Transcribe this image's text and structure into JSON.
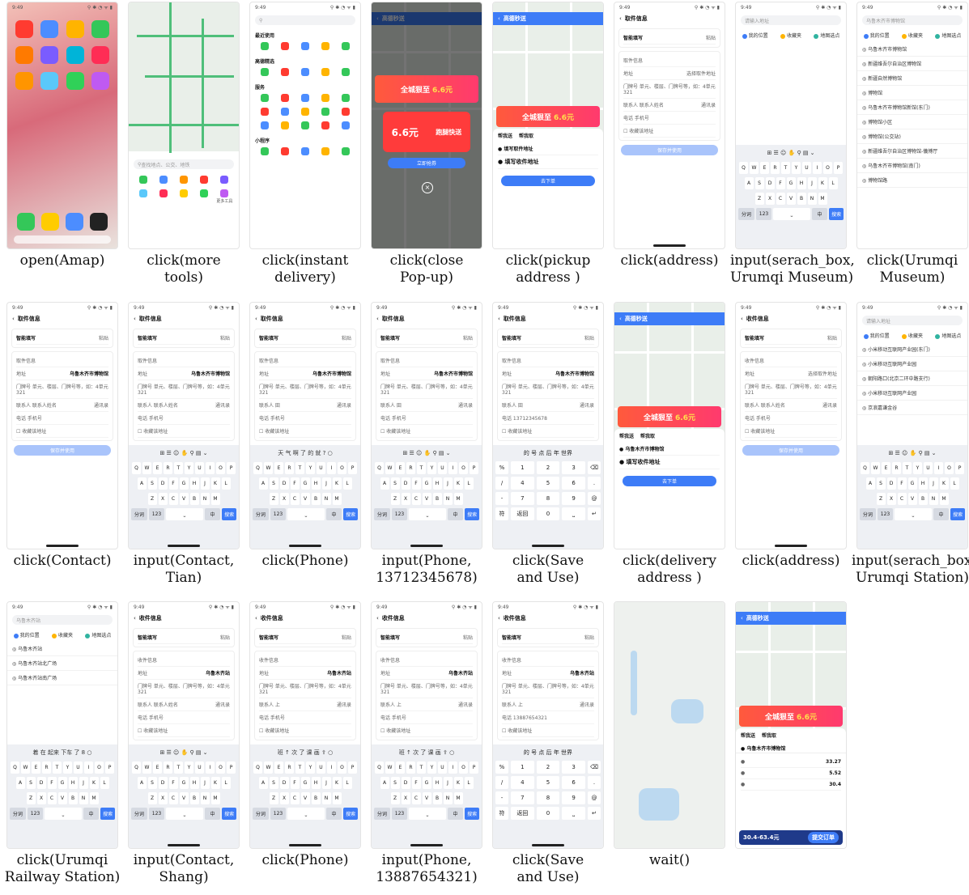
{
  "captions": [
    [
      "open(Amap)"
    ],
    [
      "click(more",
      "tools)"
    ],
    [
      "click(instant",
      "delivery)"
    ],
    [
      "click(close",
      "Pop-up)"
    ],
    [
      "click(pickup",
      "address )"
    ],
    [
      "click(address)"
    ],
    [
      "input(serach_box,",
      "Urumqi Museum)"
    ],
    [
      "click(Urumqi",
      "Museum)"
    ],
    [
      "click(Contact)"
    ],
    [
      "input(Contact,",
      "Tian)"
    ],
    [
      "click(Phone)"
    ],
    [
      "input(Phone,",
      "13712345678)"
    ],
    [
      "click(Save",
      "and Use)"
    ],
    [
      "click(delivery",
      "address )"
    ],
    [
      "click(address)"
    ],
    [
      "input(serach_box,",
      "Urumqi Station)"
    ],
    [
      "click(Urumqi",
      "Railway Station)"
    ],
    [
      "input(Contact,",
      "Shang)"
    ],
    [
      "click(Phone)"
    ],
    [
      "input(Phone,",
      "13887654321)"
    ],
    [
      "click(Save",
      "and Use)"
    ],
    [
      "wait()"
    ]
  ],
  "status": {
    "time": "9:49",
    "icons": "⚲ ✱ ◔ ᯤ ▮"
  },
  "pickup_header": "取件信息",
  "receive_header": "收件信息",
  "smart_fill": "智能填写",
  "paste": "粘贴",
  "pickup_info": "取件信息",
  "receive_info": "收件信息",
  "address_label": "地址",
  "address_museum": "乌鲁木齐市博物馆",
  "address_station": "乌鲁木齐站",
  "address_placeholder": "选择取件地址",
  "doorplate": "门牌号 单元、楼层、门牌号等，如：4单元321",
  "contact_label": "联系人",
  "contact_placeholder": "联系人姓名",
  "contact_tian": "田",
  "contact_shang": "上",
  "addressbook": "通讯录",
  "phone_label": "电话",
  "phone_placeholder": "手机号",
  "phone_tian": "13712345678",
  "phone_shang": "13887654321",
  "save_addr": "收藏该地址",
  "save_use": "保存并使用",
  "search_placeholder": "请输入地址",
  "search_museum": "乌鲁木齐市博物馆",
  "search_station": "乌鲁木齐站",
  "tabs": [
    "我的位置",
    "收藏夹",
    "地图选点"
  ],
  "amap_title": "高德秒送",
  "promo": "全城狠至",
  "promo_num": "6.6元",
  "coupon": "6.6元",
  "coupon_tag": "跑腿快送",
  "claim": "立即抢券",
  "send_tabs": [
    "帮我送",
    "帮我取"
  ],
  "fill_pickup": "填写取件地址",
  "fill_delivery": "填写收件地址",
  "order_btn": "去下单",
  "submit_btn": "提交订单",
  "price_range": "30.4-63.4元",
  "price_a": "33.27",
  "price_b": "5.52",
  "price_c": "30.4",
  "home_search": "查找地点、公交、地铁",
  "more_tools": "更多工具",
  "section_recent": "最近使用",
  "section_hot": "高德精选",
  "section_service": "服务",
  "section_mini": "小程序",
  "museum_results": [
    "乌鲁木齐市博物馆",
    "新疆维吾尔自治区博物馆",
    "新疆自然博物馆",
    "博物馆",
    "乌鲁木齐市博物馆新馆(东门)",
    "博物馆小区",
    "博物馆(公交站)",
    "新疆维吾尔自治区博物馆-儀博厅",
    "乌鲁木齐市博物馆(南门)",
    "博物馆路"
  ],
  "station_results": [
    "小米移动互联网产业园(东门)",
    "小米移动互联网产业园",
    "朝阳路口(北京二环中路支行)",
    "小米移动互联网产业园",
    "京浪嘉谦金谷"
  ],
  "station_results2": [
    "乌鲁木齐站",
    "乌鲁木齐站北广场",
    "乌鲁木齐站南广场"
  ],
  "kb_rows": [
    [
      "Q",
      "W",
      "E",
      "R",
      "T",
      "Y",
      "U",
      "I",
      "O",
      "P"
    ],
    [
      "A",
      "S",
      "D",
      "F",
      "G",
      "H",
      "J",
      "K",
      "L"
    ],
    [
      "Z",
      "X",
      "C",
      "V",
      "B",
      "N",
      "M"
    ]
  ],
  "kb_keys": {
    "fn": "分词",
    "num": "123",
    "space": "⎵",
    "cn": "中",
    "del": "⌫",
    "go": "搜索"
  },
  "num_keys": [
    "1",
    "2",
    "3",
    "4",
    "5",
    "6",
    "7",
    "8",
    "9",
    "0"
  ],
  "num_side": {
    "pct": "%",
    "slash": "/",
    "dash": "-",
    "plus": "+",
    "sym": "符",
    "back": "返回"
  },
  "cand_cn": "天 气 啊 了 的 就 ? ○",
  "cand_num": "的 号 点 后 年 世界",
  "cand_shang": "班 ↑ 次 了 课 画 ⇪ ○",
  "cand_station": "着 在 起来 下车 了 8 ○",
  "app_colors": [
    "#ff3b30",
    "#4c8dff",
    "#ffb400",
    "#34c759",
    "#ff7a00",
    "#7a5cff",
    "#00b4d8",
    "#ff2d55",
    "#ff9500",
    "#5ac8fa",
    "#30d158",
    "#bf5af2"
  ]
}
